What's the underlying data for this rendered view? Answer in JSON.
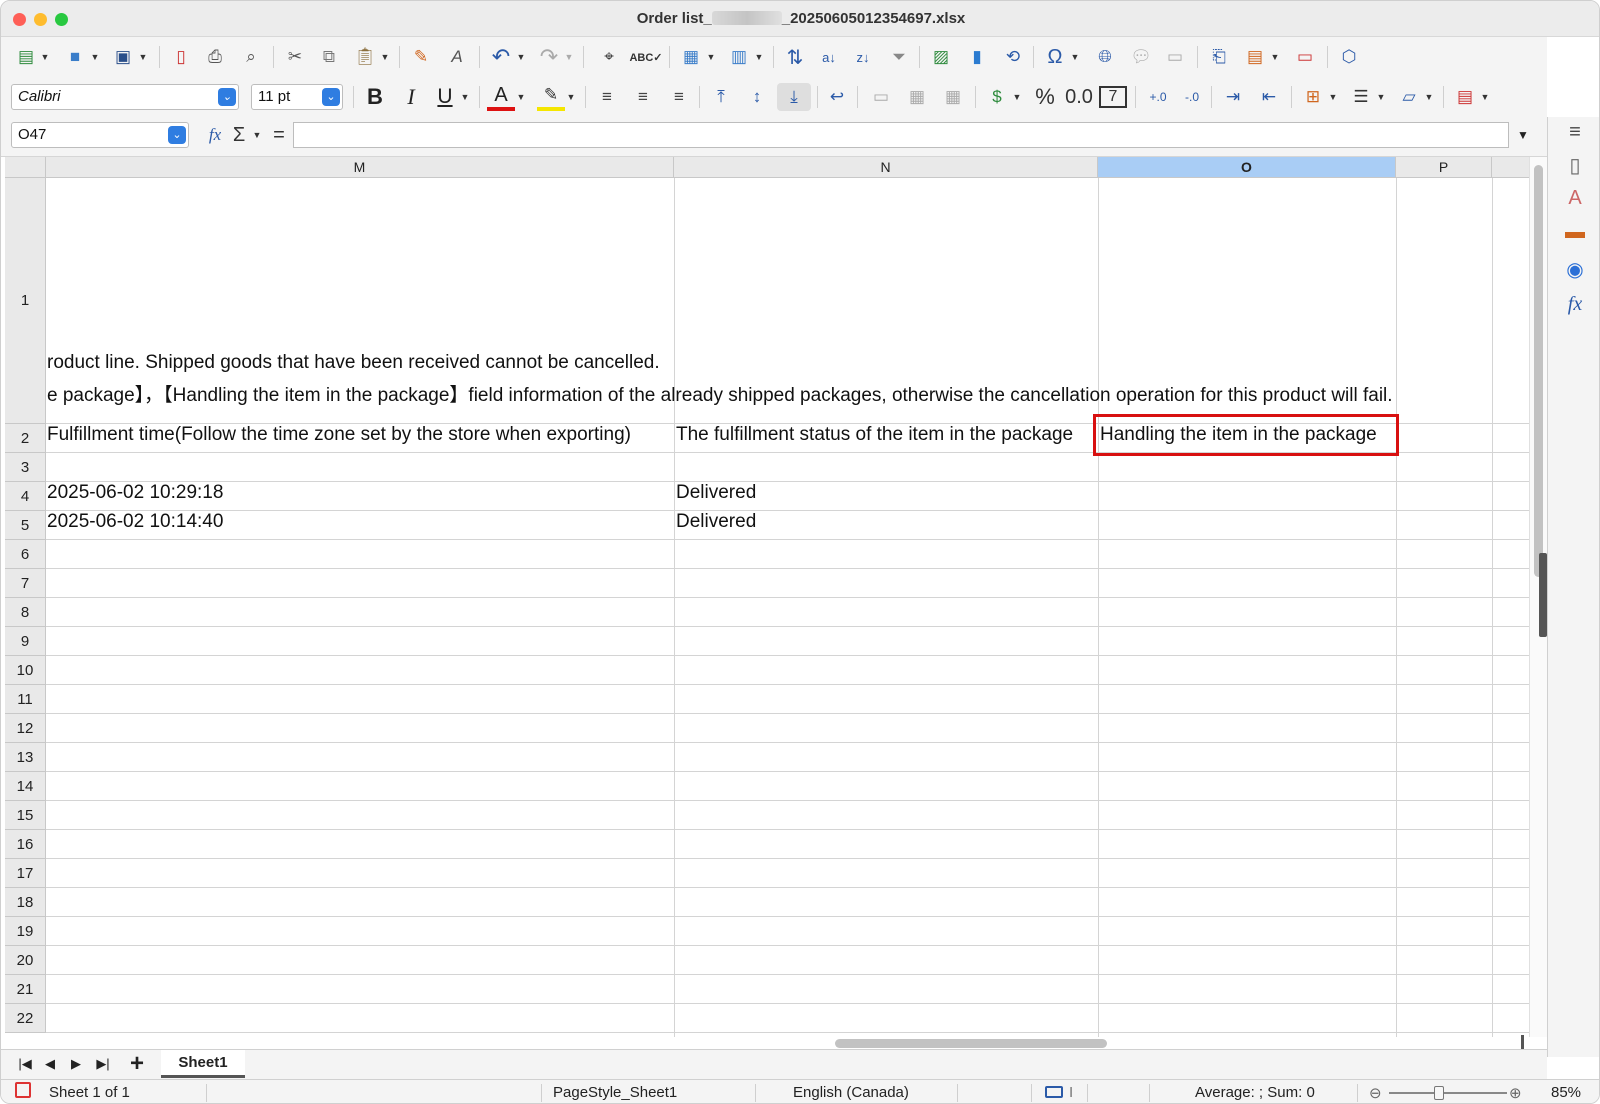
{
  "window": {
    "title_prefix": "Order list_",
    "title_suffix": "_20250605012354697.xlsx"
  },
  "toolbar2": {
    "font_name": "Calibri",
    "font_size": "11 pt"
  },
  "formula": {
    "cell_ref": "O47",
    "fx_symbol": "fx",
    "sum_symbol": "Σ",
    "equals_symbol": "="
  },
  "columns": [
    "M",
    "N",
    "O",
    "P"
  ],
  "selected_column": "O",
  "row_numbers": [
    "1",
    "2",
    "3",
    "4",
    "5",
    "6",
    "7",
    "8",
    "9",
    "10",
    "11",
    "12",
    "13",
    "14",
    "15",
    "16",
    "17",
    "18",
    "19",
    "20",
    "21",
    "22"
  ],
  "row1": {
    "line1": "roduct line. Shipped goods that have been received cannot be cancelled.",
    "line2": "e package】，【Handling the item in the package】field information of the already shipped packages, otherwise the cancellation operation for this product will fail."
  },
  "headers": {
    "M": "Fulfillment time(Follow the time zone set by the store when exporting)",
    "N": "The fulfillment status of the item in the package",
    "O": "Handling the item in the package"
  },
  "rows": [
    {
      "M": "2025-06-02 10:29:18",
      "N": "Delivered"
    },
    {
      "M": "2025-06-02 10:14:40",
      "N": "Delivered"
    }
  ],
  "sheet_tab": "Sheet1",
  "status": {
    "sheet": "Sheet 1 of 1",
    "page_style": "PageStyle_Sheet1",
    "language": "English (Canada)",
    "summary": "Average: ; Sum: 0",
    "zoom": "85%",
    "zoom_level": 0.42
  },
  "colors": {
    "highlight": "#d81010",
    "selected_header": "#a9cdf5"
  }
}
